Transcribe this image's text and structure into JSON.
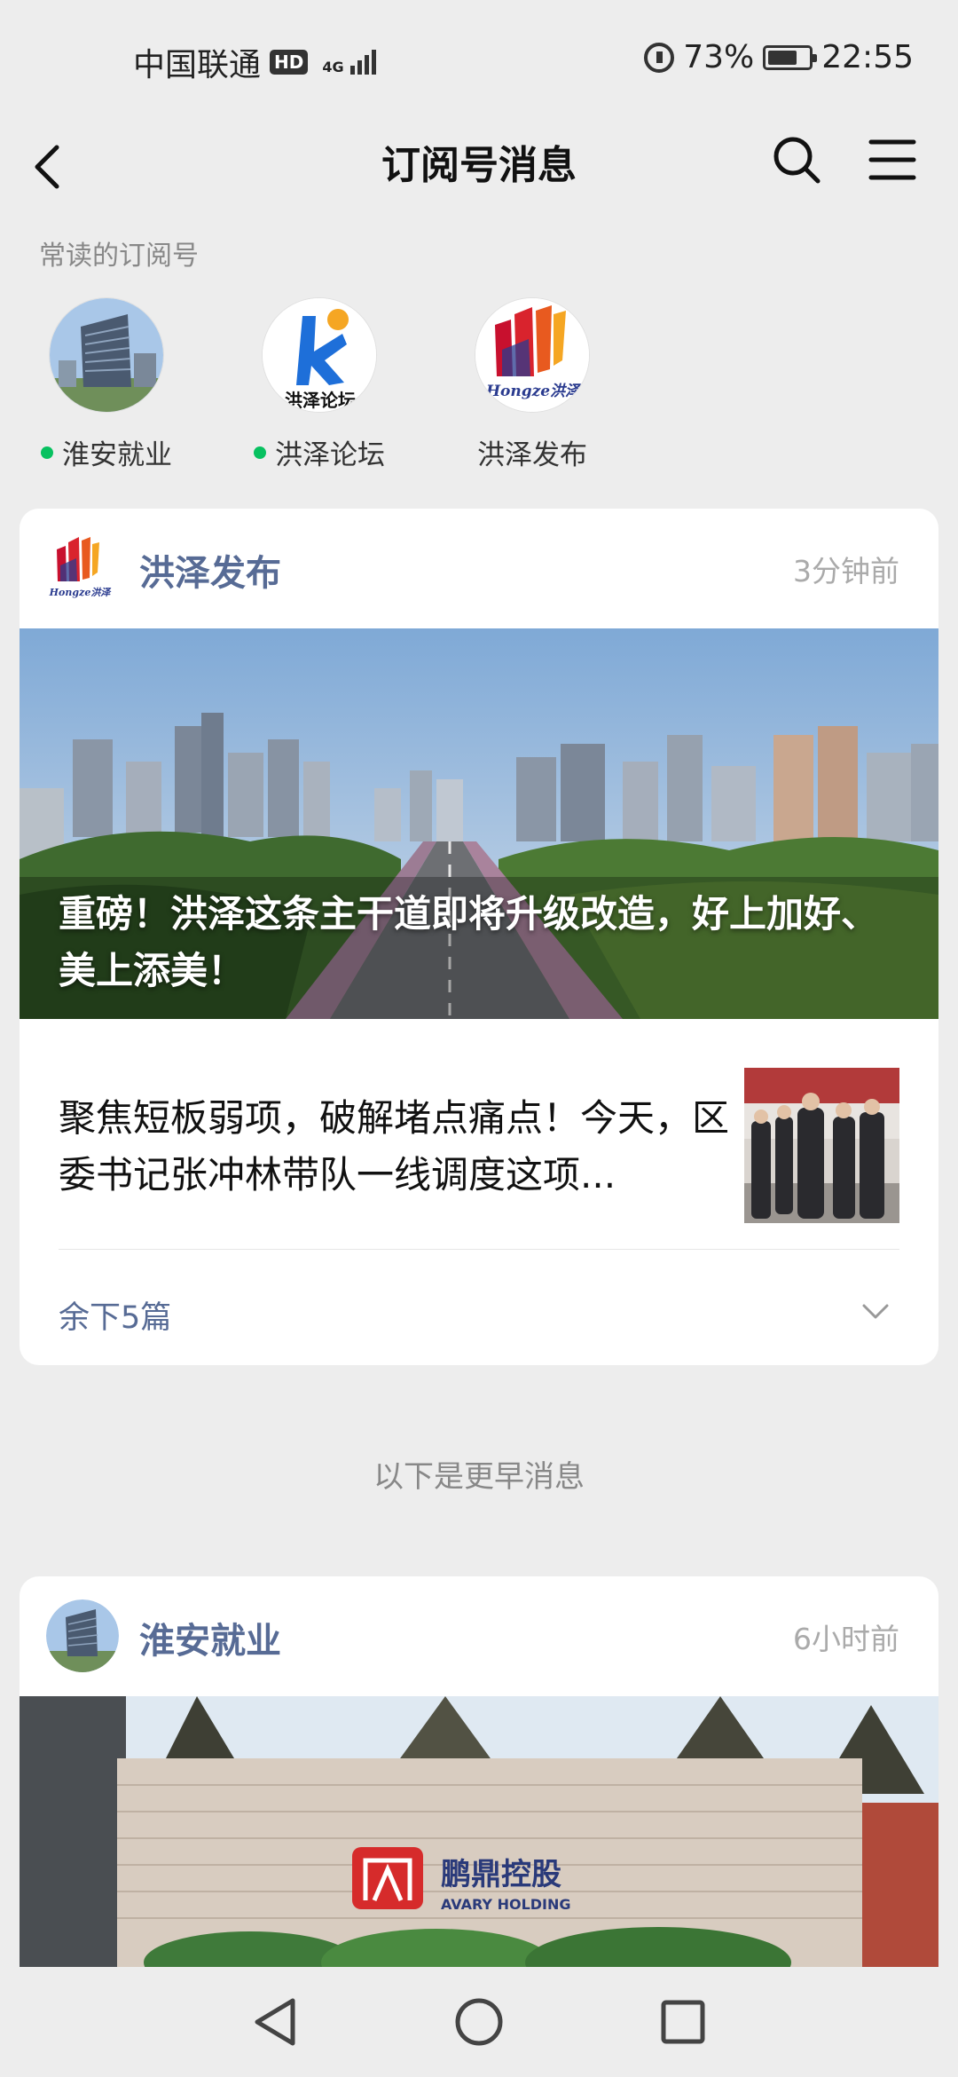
{
  "status_bar": {
    "carrier": "中国联通",
    "hd_badge": "HD",
    "network": "4G",
    "battery_percent": "73%",
    "battery_level": 0.73,
    "time": "22:55"
  },
  "header": {
    "title": "订阅号消息",
    "back_icon": "chevron-left-icon",
    "search_icon": "search-icon",
    "menu_icon": "menu-icon"
  },
  "frequent": {
    "title": "常读的订阅号",
    "items": [
      {
        "name": "淮安就业",
        "unread": true
      },
      {
        "name": "洪泽论坛",
        "unread": true
      },
      {
        "name": "洪泽发布",
        "unread": false
      }
    ]
  },
  "cards": [
    {
      "account": "洪泽发布",
      "time": "3分钟前",
      "hero_title": "重磅！洪泽这条主干道即将升级改造，好上加好、美上添美！",
      "article_title": "聚焦短板弱项，破解堵点痛点！今天，区委书记张冲林带队一线调度这项...",
      "more_label": "余下5篇"
    },
    {
      "account": "淮安就业",
      "time": "6小时前"
    }
  ],
  "logo_texts": {
    "forum": "洪泽论坛",
    "hongze_script": "Hongze洪泽",
    "company_cn": "鹏鼎控股",
    "company_en": "AVARY HOLDING"
  },
  "earlier_divider": "以下是更早消息",
  "colors": {
    "link": "#576b95",
    "unread_dot": "#07c160",
    "background": "#ededed"
  }
}
